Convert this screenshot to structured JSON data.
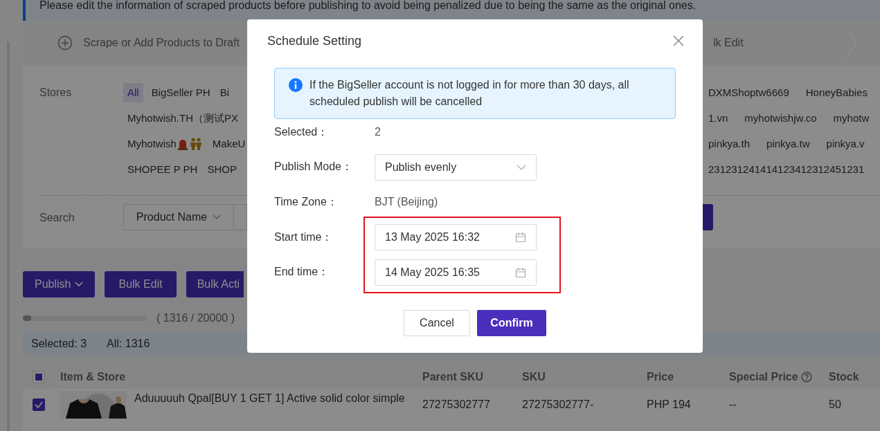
{
  "notice": {
    "text": "Please edit the information of scraped products before publishing to avoid being penalized due to being the same as the original ones."
  },
  "steps": {
    "left": "Scrape or Add Products to Draft",
    "right": "lk Edit"
  },
  "stores": {
    "label": "Stores",
    "rows": [
      {
        "left": [
          {
            "name": "All",
            "kind": "plain",
            "selected": true
          },
          {
            "name": "BigSeller PH",
            "kind": "plain",
            "selected": false
          },
          {
            "name": "Bi",
            "kind": "plain",
            "selected": false
          }
        ],
        "right": [
          {
            "name": "DXMShoptw6669",
            "kind": "plain",
            "selected": false
          },
          {
            "name": "HoneyBabies",
            "kind": "plain",
            "selected": false
          }
        ]
      },
      {
        "left": [
          {
            "name": "Myhotwish.TH（测试PX",
            "kind": "plain",
            "selected": false
          }
        ],
        "right": [
          {
            "name": "1.vn",
            "kind": "plain",
            "selected": false
          },
          {
            "name": "myhotwishjw.co",
            "kind": "plain",
            "selected": false
          },
          {
            "name": "myhotw",
            "kind": "plain",
            "selected": false
          }
        ]
      },
      {
        "left": [
          {
            "name": "Myhotwish",
            "kind": "tagged",
            "selected": false
          },
          {
            "name": "MakeU",
            "kind": "plain",
            "selected": false
          }
        ],
        "right": [
          {
            "name": "pinkya.th",
            "kind": "plain",
            "selected": false
          },
          {
            "name": "pinkya.tw",
            "kind": "plain",
            "selected": false
          },
          {
            "name": "pinkya.v",
            "kind": "plain",
            "selected": false
          }
        ]
      },
      {
        "left": [
          {
            "name": "SHOPEE P PH",
            "kind": "plain",
            "selected": false
          },
          {
            "name": "SHOP",
            "kind": "plain",
            "selected": false
          }
        ],
        "right": [
          {
            "name": "231231241414123412312451231",
            "kind": "plain",
            "selected": false
          }
        ]
      }
    ]
  },
  "search": {
    "label": "Search",
    "field": "Product Name"
  },
  "toolbar": [
    {
      "label": "Publish",
      "kind": "dropdown"
    },
    {
      "label": "Bulk Edit",
      "kind": "plain"
    },
    {
      "label": "Bulk Acti",
      "kind": "plain"
    }
  ],
  "quota": {
    "level": 0.066,
    "text": "( 1316 / 20000 )"
  },
  "selection": {
    "selected": "Selected: 3",
    "all": "All: 1316"
  },
  "table": {
    "indeterminate": true,
    "columns": [
      {
        "label": "Item & Store",
        "kind": "plain"
      },
      {
        "label": "Parent SKU",
        "kind": "plain"
      },
      {
        "label": "SKU",
        "kind": "plain"
      },
      {
        "label": "Price",
        "kind": "plain"
      },
      {
        "label": "Special Price",
        "kind": "help"
      },
      {
        "label": "Stock",
        "kind": "plain"
      }
    ],
    "rows": [
      {
        "checked": true,
        "cells": [
          "Aduuuuuh Qpal[BUY 1 GET 1] Active solid color simple",
          "27275302777",
          "27275302777-",
          "PHP 194",
          "--",
          "50"
        ]
      }
    ]
  },
  "dialog": {
    "title": "Schedule Setting",
    "alert": "If the BigSeller account is not logged in for more than 30 days, all scheduled publish will be cancelled",
    "fields": [
      {
        "label": "Selected：",
        "kind": "text",
        "value": "2",
        "highlighted": false
      },
      {
        "label": "Publish Mode：",
        "kind": "select",
        "value": "Publish evenly",
        "highlighted": false
      },
      {
        "label": "Time Zone：",
        "kind": "text",
        "value": "BJT (Beijing)",
        "highlighted": false
      },
      {
        "label": "Start time：",
        "kind": "date",
        "value": "13 May 2025 16:32",
        "highlighted": true
      },
      {
        "label": "End time：",
        "kind": "date",
        "value": "14 May 2025 16:35",
        "highlighted": true
      }
    ],
    "buttons": [
      {
        "label": "Cancel",
        "kind": "default"
      },
      {
        "label": "Confirm",
        "kind": "primary"
      }
    ]
  }
}
